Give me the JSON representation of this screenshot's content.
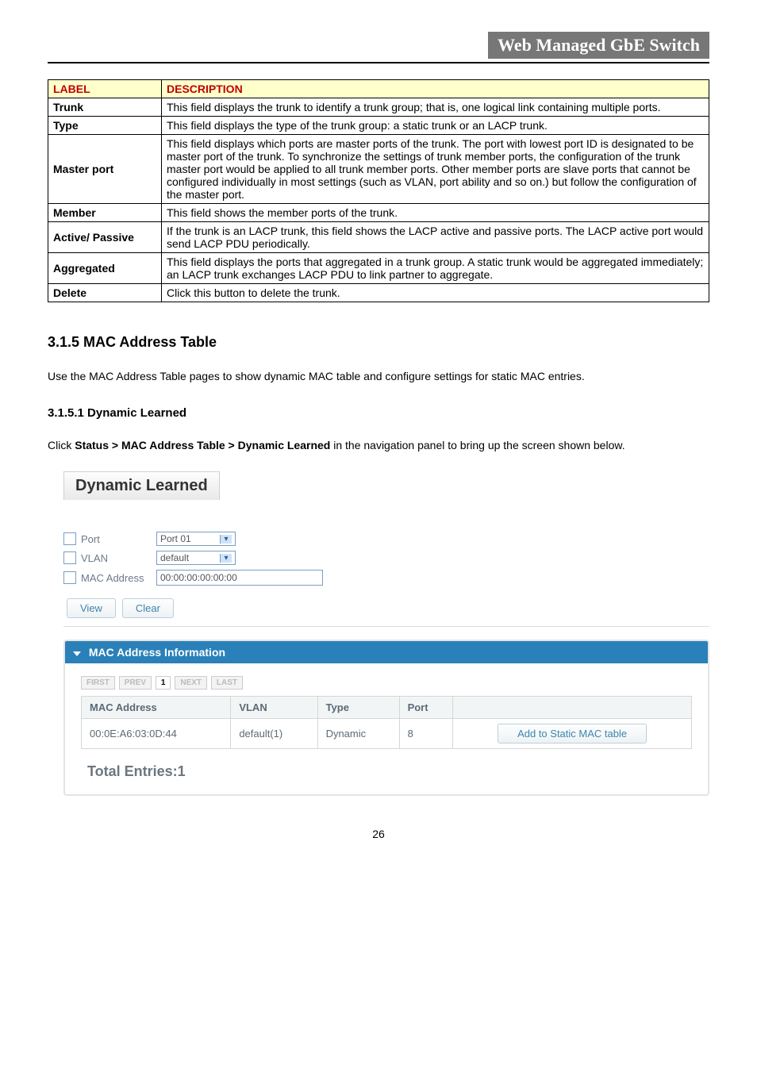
{
  "header": {
    "title": "Web Managed GbE Switch"
  },
  "desc_table": {
    "headers": [
      "LABEL",
      "DESCRIPTION"
    ],
    "rows": [
      {
        "label": "Trunk",
        "desc": "This field displays the trunk to identify a trunk group; that is, one logical link containing multiple ports."
      },
      {
        "label": "Type",
        "desc": "This field displays the type of the trunk group: a static trunk or an LACP trunk."
      },
      {
        "label": "Master port",
        "desc": "This field displays which ports are master ports of the trunk. The port with lowest port ID is designated to be master port of the trunk. To synchronize the settings of trunk member ports, the configuration of the trunk master port would be applied to all trunk member ports. Other member ports are slave ports that cannot be configured individually in most settings (such as VLAN, port ability and so on.) but follow the configuration of the master port."
      },
      {
        "label": "Member",
        "desc": "This field shows the member ports of the trunk."
      },
      {
        "label": "Active/ Passive",
        "desc": "If the trunk is an LACP trunk, this field shows the LACP active and passive ports. The LACP active port would send LACP PDU periodically."
      },
      {
        "label": "Aggregated",
        "desc": "This field displays the ports that aggregated in a trunk group. A static trunk would be aggregated immediately; an LACP trunk exchanges LACP PDU to link partner to aggregate."
      },
      {
        "label": "Delete",
        "desc": "Click this button to delete the trunk."
      }
    ]
  },
  "section": {
    "title": "3.1.5 MAC Address Table",
    "intro": "Use the MAC Address Table pages to show dynamic MAC table and configure settings for static MAC entries.",
    "sub_title": "3.1.5.1 Dynamic Learned",
    "sub_intro_pre": "Click ",
    "sub_intro_bold": "Status > MAC Address Table > Dynamic Learned",
    "sub_intro_post": " in the navigation panel to bring up the screen shown below."
  },
  "ui": {
    "panel_title": "Dynamic Learned",
    "filters": {
      "port_label": "Port",
      "port_value": "Port 01",
      "vlan_label": "VLAN",
      "vlan_value": "default",
      "mac_label": "MAC Address",
      "mac_value": "00:00:00:00:00:00"
    },
    "buttons": {
      "view": "View",
      "clear": "Clear"
    },
    "mac_info": {
      "header": "MAC Address Information",
      "pager": {
        "first": "FIRST",
        "prev": "PREV",
        "page": "1",
        "next": "NEXT",
        "last": "LAST"
      },
      "columns": [
        "MAC Address",
        "VLAN",
        "Type",
        "Port",
        ""
      ],
      "rows": [
        {
          "mac": "00:0E:A6:03:0D:44",
          "vlan": "default(1)",
          "type": "Dynamic",
          "port": "8",
          "action": "Add to Static MAC table"
        }
      ],
      "total_label": "Total Entries:1"
    }
  },
  "page_number": "26"
}
